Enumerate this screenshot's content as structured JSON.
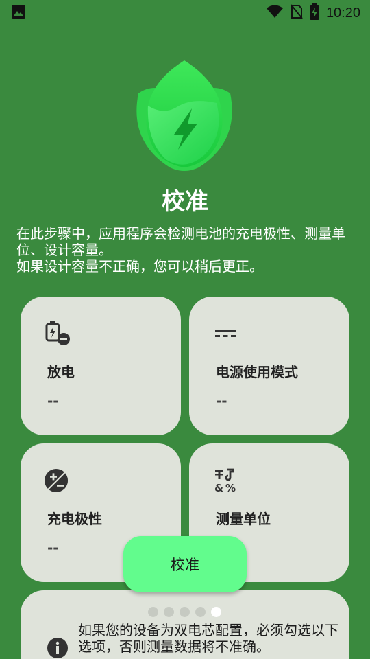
{
  "status_bar": {
    "time": "10:20",
    "icons": [
      "image-icon",
      "wifi-icon",
      "no-sim-icon",
      "battery-charging-icon"
    ]
  },
  "header": {
    "logo": "leaf-battery-logo",
    "title": "校准",
    "description": [
      "在此步骤中，应用程序会检测电池的充电极性、测量单位、设计容量。",
      "如果设计容量不正确，您可以稍后更正。"
    ]
  },
  "cards": [
    {
      "icon": "battery-discharge-icon",
      "label": "放电",
      "value": "--"
    },
    {
      "icon": "dc-power-icon",
      "label": "电源使用模式",
      "value": "--"
    },
    {
      "icon": "exposure-plus-minus-icon",
      "label": "充电极性",
      "value": "--"
    },
    {
      "icon": "symbols-units-icon",
      "label": "测量单位",
      "value": ""
    }
  ],
  "fab": {
    "label": "校准"
  },
  "pager": {
    "count": 5,
    "active_index": 4
  },
  "info_card": {
    "icon": "info-icon",
    "text": "如果您的设备为双电芯配置，必须勾选以下选项，否则测量数据将不准确。"
  },
  "colors": {
    "background": "#3a8a3e",
    "card": "#dfe3da",
    "fab": "#62fc8d",
    "logo_green": "#27e04a"
  }
}
